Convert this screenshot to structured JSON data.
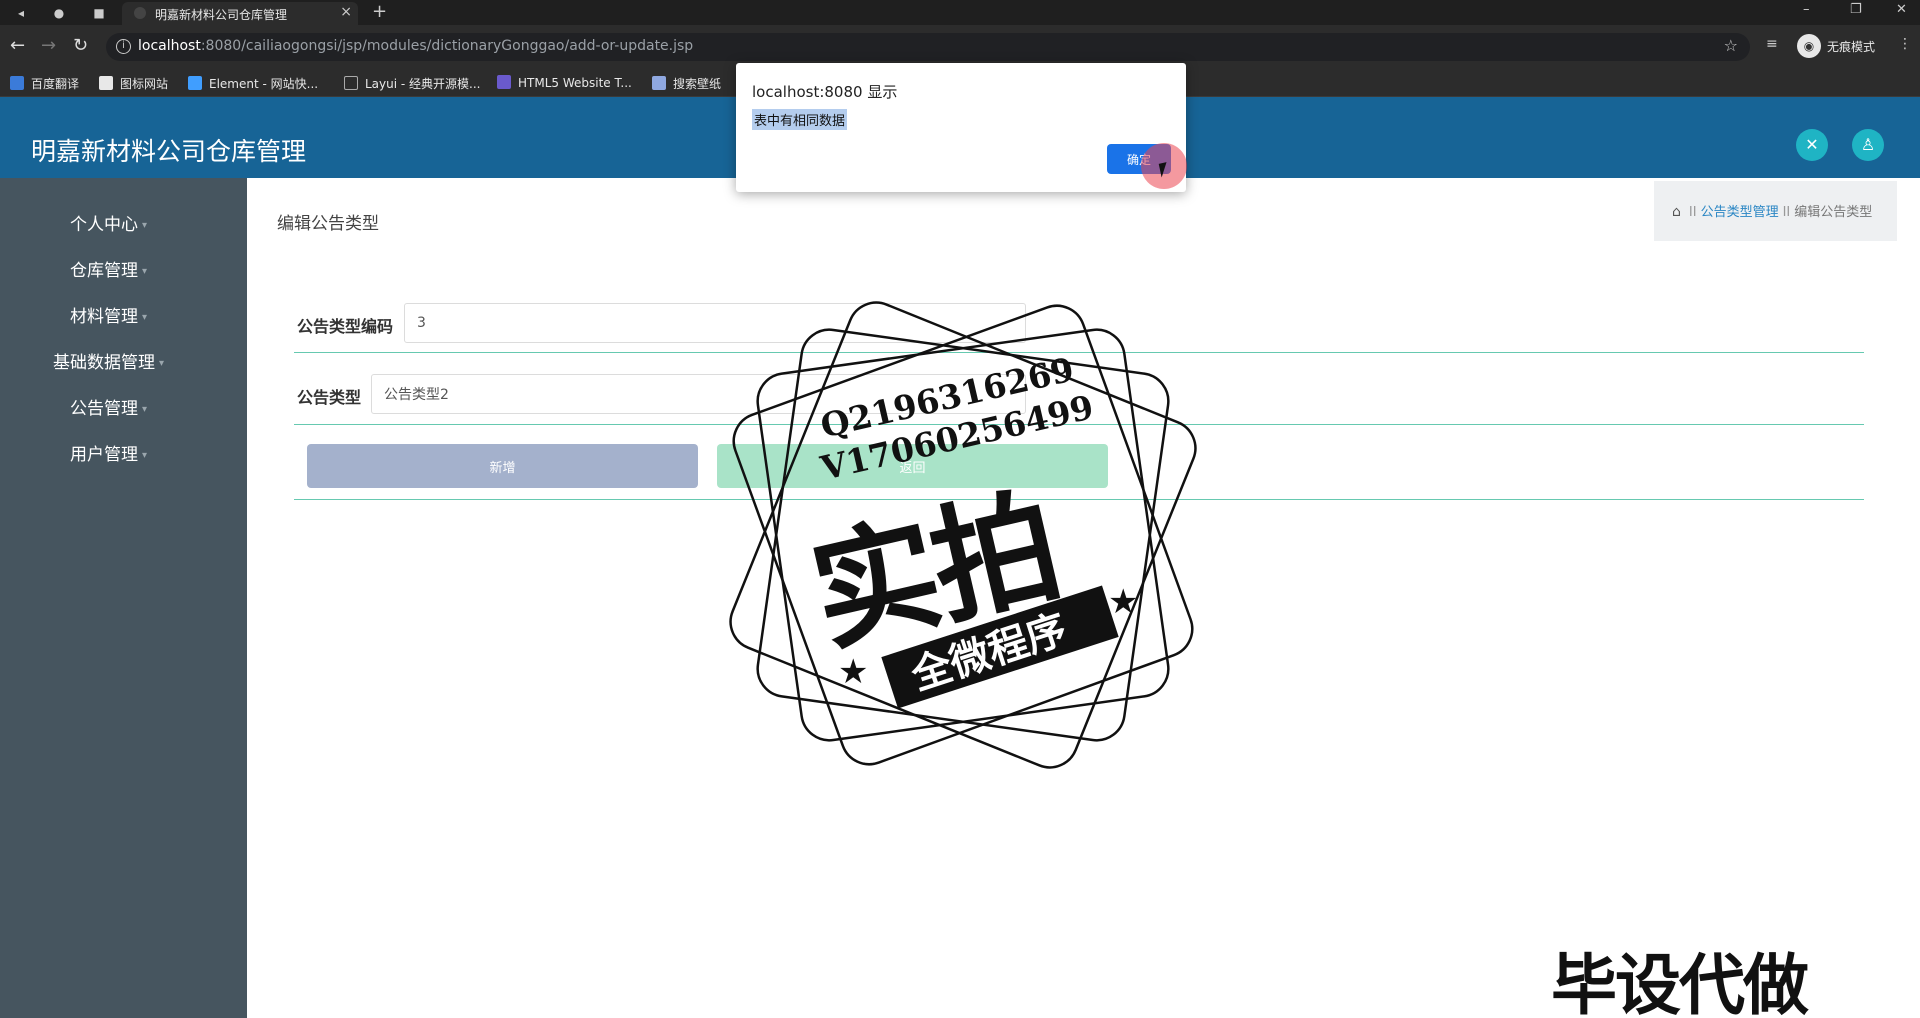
{
  "browser": {
    "tab_title": "明嘉新材料公司仓库管理",
    "url_host": "localhost",
    "url_path": ":8080/cailiaogongsi/jsp/modules/dictionaryGonggao/add-or-update.jsp",
    "incognito_label": "无痕模式",
    "bookmarks": [
      "百度翻译",
      "图标网站",
      "Element - 网站快...",
      "Layui - 经典开源模...",
      "HTML5 Website T...",
      "搜索壁纸"
    ]
  },
  "header": {
    "title": "明嘉新材料公司仓库管理"
  },
  "sidebar": {
    "items": [
      {
        "label": "个人中心"
      },
      {
        "label": "仓库管理"
      },
      {
        "label": "材料管理"
      },
      {
        "label": "基础数据管理"
      },
      {
        "label": "公告管理"
      },
      {
        "label": "用户管理"
      }
    ]
  },
  "page": {
    "title": "编辑公告类型",
    "breadcrumb": {
      "sep": "II",
      "link": "公告类型管理",
      "current": "编辑公告类型"
    },
    "form": {
      "code_label": "公告类型编码",
      "code_value": "3",
      "type_label": "公告类型",
      "type_value": "公告类型2",
      "add_button": "新增",
      "back_button": "返回"
    }
  },
  "alert": {
    "title": "localhost:8080 显示",
    "message": "表中有相同数据",
    "ok_button": "确定"
  },
  "watermark": {
    "q_line": "Q2196316269",
    "v_line": "V17060256499",
    "main": "实拍",
    "sub": "全微程序",
    "corner": "毕设代做"
  },
  "colors": {
    "header": "#176496",
    "sidebar": "#46555f",
    "accent_line": "#66c9b0",
    "add_button": "#a4b1cc",
    "back_button": "#a9e3c8",
    "alert_ok": "#1a73e8"
  }
}
